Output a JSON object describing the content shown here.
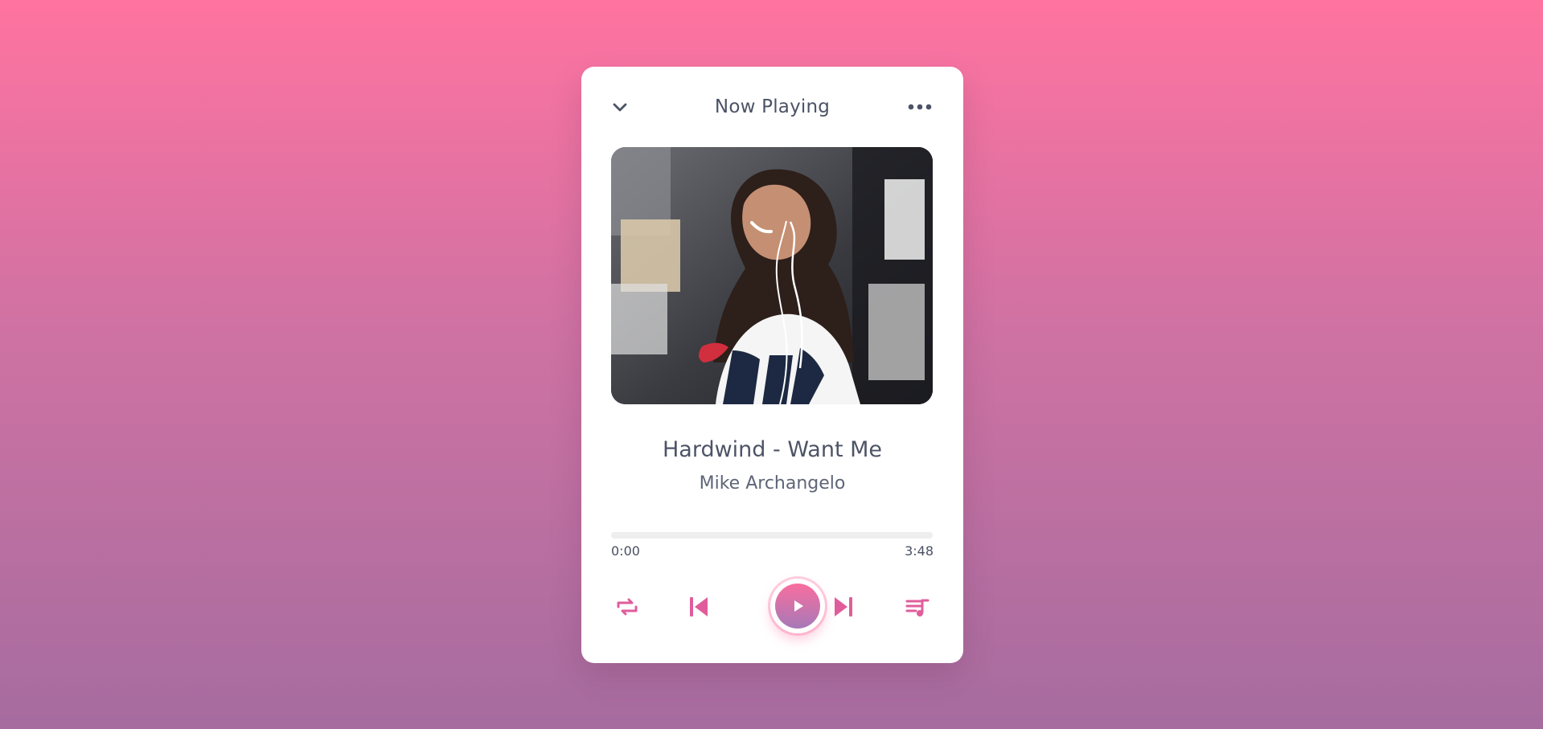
{
  "header": {
    "title": "Now Playing",
    "left_icon": "chevron-down-icon",
    "right_icon": "more-icon"
  },
  "track": {
    "title": "Hardwind - Want Me",
    "artist": "Mike Archangelo"
  },
  "progress": {
    "current": "0:00",
    "duration": "3:48",
    "value": 0
  },
  "controls": {
    "icons": [
      "repeat-icon",
      "previous-icon",
      "play-icon",
      "next-icon",
      "playlist-icon"
    ]
  },
  "colors": {
    "accent": "#ff73a0",
    "text": "#4d5467",
    "play_gradient_start": "#f96e9f",
    "play_gradient_end": "#a679b7"
  }
}
